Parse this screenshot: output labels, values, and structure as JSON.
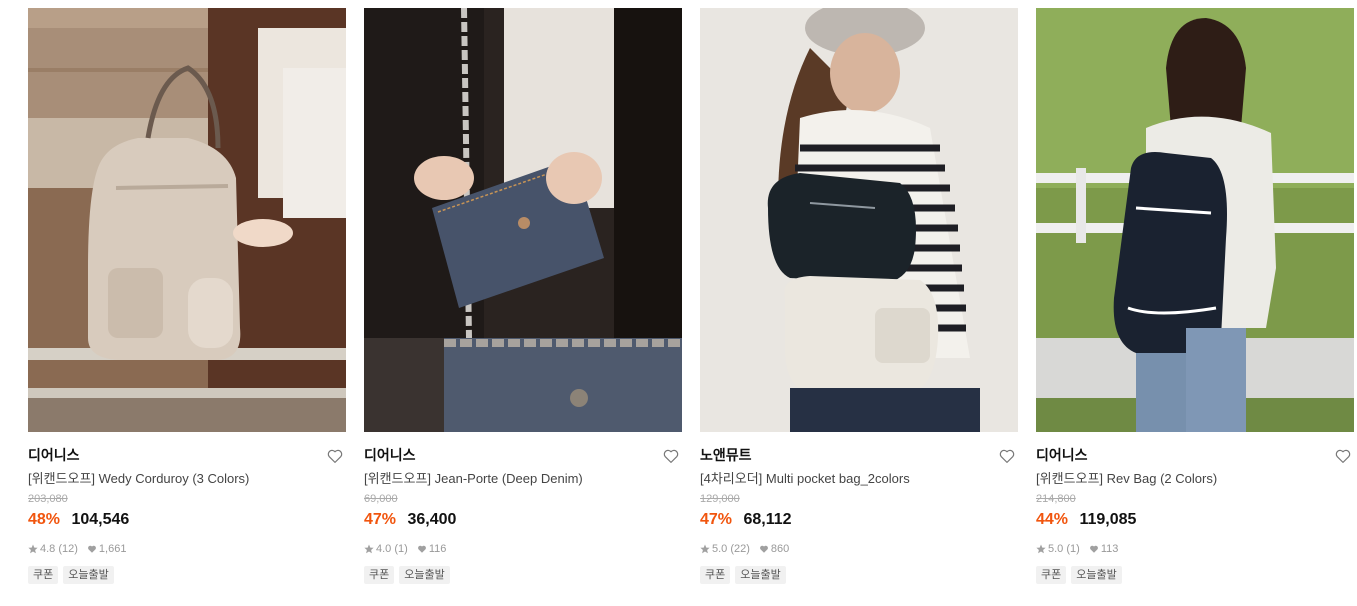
{
  "products": [
    {
      "brand": "디어니스",
      "name": "[위캔드오프] Wedy Corduroy (3 Colors)",
      "original_price": "203,080",
      "discount": "48%",
      "price": "104,546",
      "rating": "4.8",
      "review_count": "(12)",
      "likes": "1,661",
      "tags": [
        "쿠폰",
        "오늘출발"
      ],
      "image_desc": "beige-corduroy-backpack-photo"
    },
    {
      "brand": "디어니스",
      "name": "[위캔드오프] Jean-Porte (Deep Denim)",
      "original_price": "69,000",
      "discount": "47%",
      "price": "36,400",
      "rating": "4.0",
      "review_count": "(1)",
      "likes": "116",
      "tags": [
        "쿠폰",
        "오늘출발"
      ],
      "image_desc": "denim-card-holder-photo"
    },
    {
      "brand": "노앤뮤트",
      "name": "[4차리오더] Multi pocket bag_2colors",
      "original_price": "129,000",
      "discount": "47%",
      "price": "68,112",
      "rating": "5.0",
      "review_count": "(22)",
      "likes": "860",
      "tags": [
        "쿠폰",
        "오늘출발"
      ],
      "image_desc": "multi-pocket-shoulder-bag-photo"
    },
    {
      "brand": "디어니스",
      "name": "[위캔드오프] Rev Bag (2 Colors)",
      "original_price": "214,800",
      "discount": "44%",
      "price": "119,085",
      "rating": "5.0",
      "review_count": "(1)",
      "likes": "113",
      "tags": [
        "쿠폰",
        "오늘출발"
      ],
      "image_desc": "denim-backpack-photo"
    }
  ],
  "colors": {
    "discount": "#f1550e",
    "text": "#111111",
    "muted": "#999999",
    "tag_bg": "#f1f1f1"
  },
  "icons": {
    "like": "heart-outline-icon",
    "rating": "star-icon",
    "likes_count": "heart-filled-icon"
  }
}
